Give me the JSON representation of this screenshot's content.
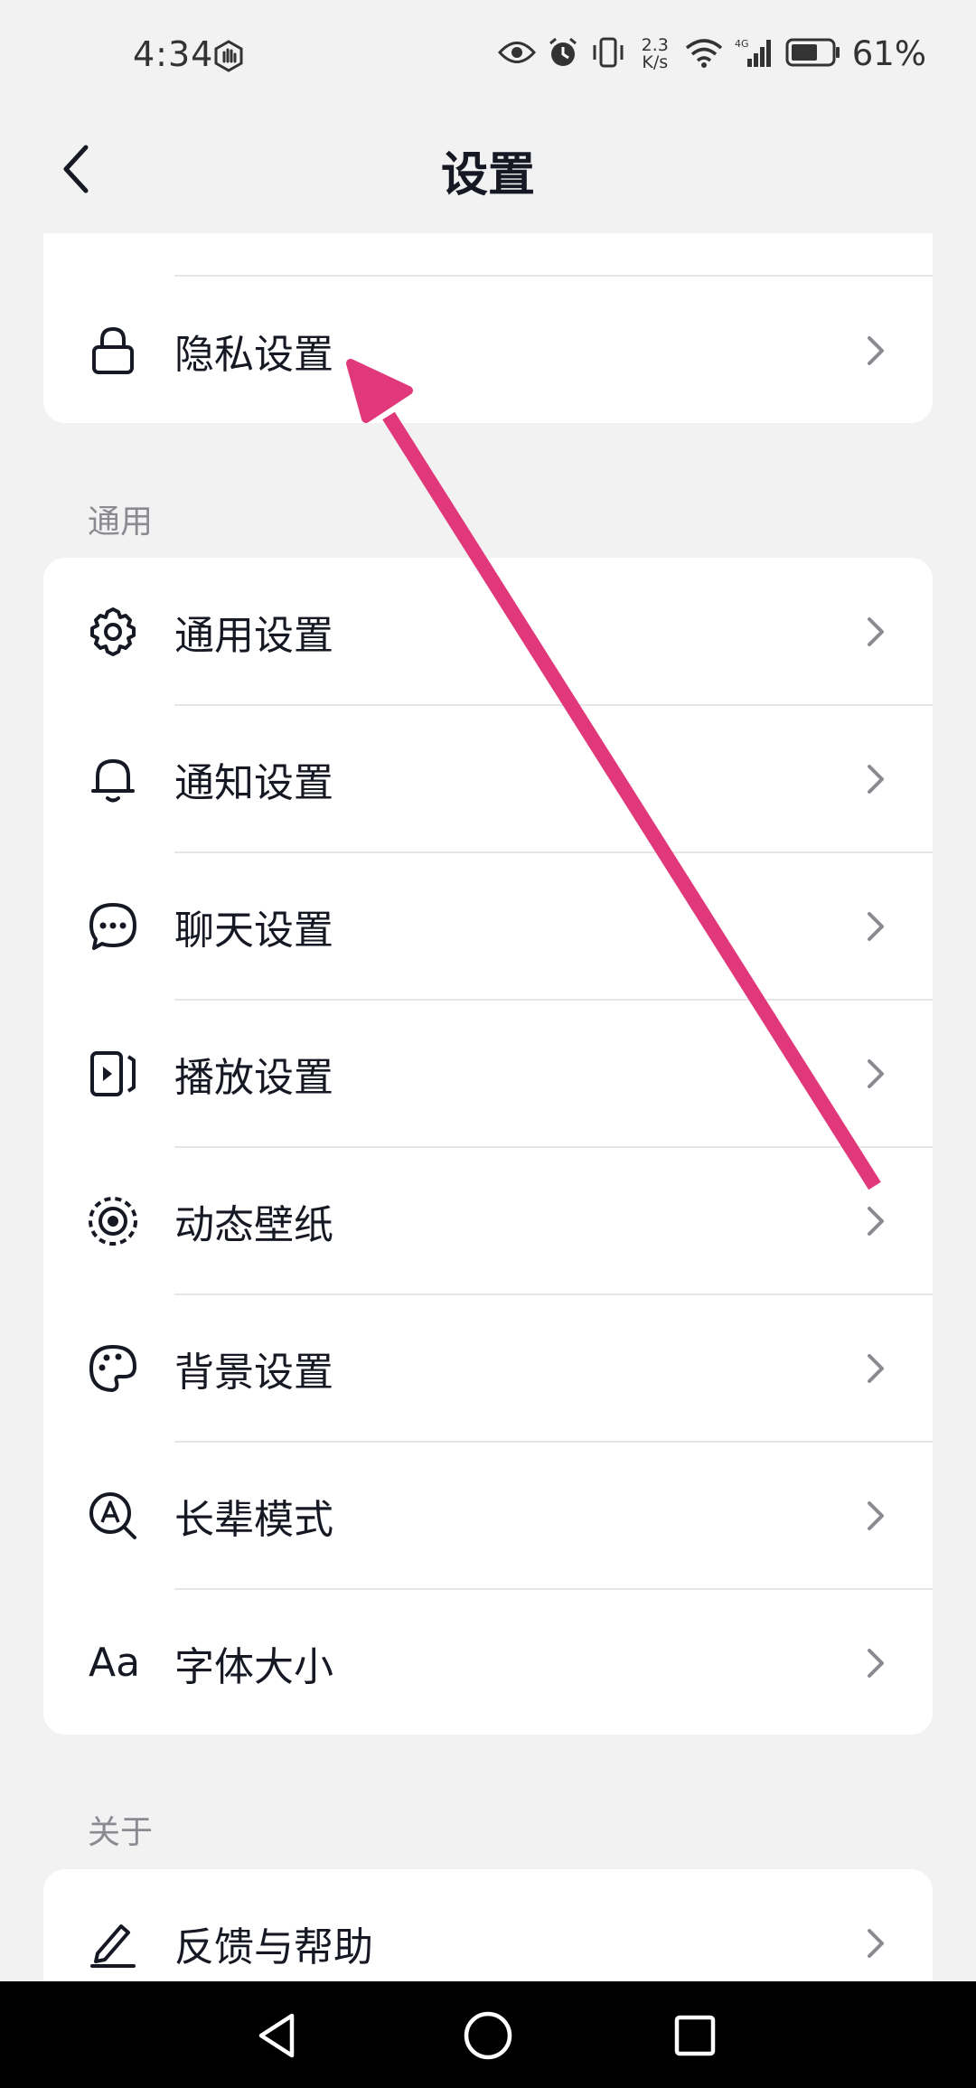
{
  "status": {
    "time": "4:34",
    "speed_top": "2.3",
    "speed_bottom": "K/s",
    "network": "4G",
    "battery": "61%"
  },
  "nav": {
    "title": "设置"
  },
  "top_card": {
    "items": [
      {
        "label": "隐私设置",
        "icon": "lock-icon"
      }
    ]
  },
  "sections": {
    "general": {
      "title": "通用",
      "items": [
        {
          "label": "通用设置",
          "icon": "gear-icon"
        },
        {
          "label": "通知设置",
          "icon": "bell-icon"
        },
        {
          "label": "聊天设置",
          "icon": "chat-bubble-icon"
        },
        {
          "label": "播放设置",
          "icon": "play-panel-icon"
        },
        {
          "label": "动态壁纸",
          "icon": "live-wallpaper-icon"
        },
        {
          "label": "背景设置",
          "icon": "palette-icon"
        },
        {
          "label": "长辈模式",
          "icon": "elder-mode-icon"
        },
        {
          "label": "字体大小",
          "icon": "font-size-icon",
          "glyph": "Aa"
        }
      ]
    },
    "about": {
      "title": "关于",
      "items": [
        {
          "label": "反馈与帮助",
          "icon": "pencil-icon"
        }
      ]
    }
  },
  "colors": {
    "annotation_arrow": "#e0387a",
    "background": "#f2f2f2",
    "card": "#ffffff"
  }
}
